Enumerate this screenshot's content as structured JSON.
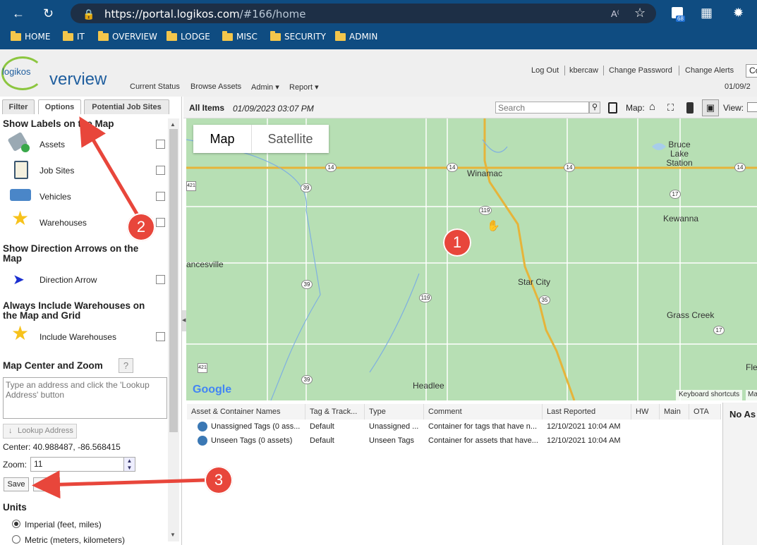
{
  "browser": {
    "url_host": "https://portal.logikos.com",
    "url_path": "/#166/home",
    "badge_count": "68",
    "bookmarks": [
      "HOME",
      "IT",
      "OVERVIEW",
      "LODGE",
      "MISC",
      "SECURITY",
      "ADMIN"
    ]
  },
  "app": {
    "logo_small": "logikos",
    "logo_big": "verview",
    "top_links": [
      "Log Out",
      "kbercaw",
      "Change Password",
      "Change Alerts"
    ],
    "top_input_value": "Co",
    "nav": [
      "Current Status",
      "Browse Assets",
      "Admin ▾",
      "Report ▾"
    ],
    "date_right": "01/09/2"
  },
  "left": {
    "tabs": [
      "Filter",
      "Options",
      "Potential Job Sites"
    ],
    "labels_title": "Show Labels on the Map",
    "label_items": [
      "Assets",
      "Job Sites",
      "Vehicles",
      "Warehouses"
    ],
    "arrows_title_1": "Show Direction Arrows on the",
    "arrows_title_2": "Map",
    "arrow_item": "Direction Arrow",
    "warehouses_title_1": "Always Include Warehouses on",
    "warehouses_title_2": "the Map and Grid",
    "include_item": "Include Warehouses",
    "center_title": "Map Center and Zoom",
    "help": "?",
    "address_placeholder": "Type an address and click the 'Lookup Address' button",
    "lookup_label": "Lookup Address",
    "center_text": "Center:  40.988487, -86.568415",
    "zoom_label": "Zoom:",
    "zoom_value": "11",
    "save_label": "Save",
    "units_title": "Units",
    "unit_imperial": "Imperial (feet, miles)",
    "unit_metric": "Metric (meters, kilometers)"
  },
  "toolbar": {
    "all_items": "All Items",
    "timestamp": "01/09/2023 03:07 PM",
    "search_placeholder": "Search",
    "map_label": "Map:",
    "view_label": "View:"
  },
  "map": {
    "btn_map": "Map",
    "btn_satellite": "Satellite",
    "places": [
      "Bruce Lake Station",
      "Winamac",
      "Kewanna",
      "ancesville",
      "Star City",
      "Grass Creek",
      "Headlee",
      "Fle"
    ],
    "route_shields": [
      "14",
      "14",
      "14",
      "14",
      "421",
      "39",
      "119",
      "17",
      "39",
      "119",
      "35",
      "17",
      "421",
      "39"
    ],
    "attribution": "Google",
    "shortcuts": "Keyboard shortcuts",
    "attr_more": "Ma"
  },
  "grid": {
    "headers": [
      "Asset & Container Names",
      "Tag & Track...",
      "Type",
      "Comment",
      "Last Reported",
      "HW",
      "Main",
      "OTA"
    ],
    "rows": [
      [
        "Unassigned Tags (0 ass...",
        "Default",
        "Unassigned ...",
        "Container for tags that have n...",
        "12/10/2021 10:04 AM"
      ],
      [
        "Unseen Tags (0 assets)",
        "Default",
        "Unseen Tags",
        "Container for assets that have...",
        "12/10/2021 10:04 AM"
      ]
    ],
    "right_pane": "No As"
  },
  "annotations": [
    "1",
    "2",
    "3"
  ],
  "colors": {
    "chrome": "#0f4c81",
    "accent": "#e8463b",
    "map_green": "#b7dfb4",
    "road": "#f2c24a"
  }
}
